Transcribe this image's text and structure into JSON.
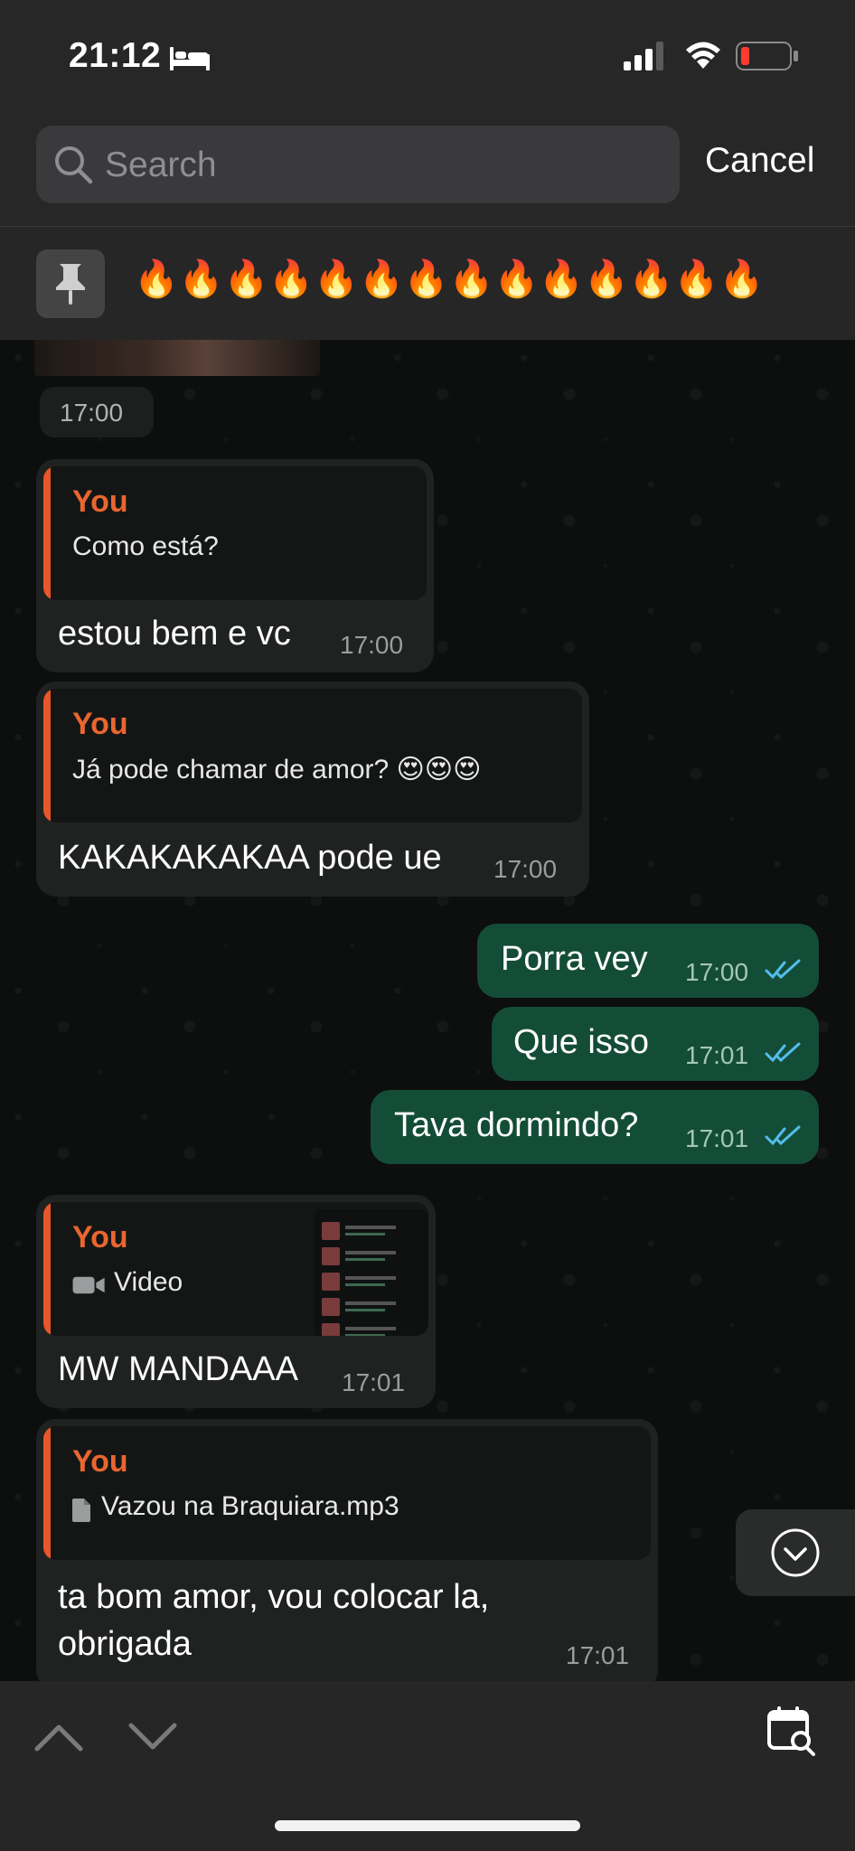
{
  "status_bar": {
    "time": "21:12"
  },
  "search": {
    "placeholder": "Search",
    "cancel_label": "Cancel"
  },
  "pinned": {
    "text": "🔥🔥🔥🔥🔥🔥🔥🔥🔥🔥🔥🔥🔥🔥"
  },
  "messages": [
    {
      "type": "time-only",
      "time": "17:00"
    },
    {
      "direction": "in",
      "reply_name": "You",
      "reply_text": "Como está?",
      "text": "estou bem e vc",
      "time": "17:00"
    },
    {
      "direction": "in",
      "reply_name": "You",
      "reply_text": "Já pode chamar de amor? 😍😍😍",
      "text": "KAKAKAKAKAA pode ue",
      "time": "17:00"
    },
    {
      "direction": "out",
      "text": "Porra vey",
      "time": "17:00",
      "status": "read"
    },
    {
      "direction": "out",
      "text": "Que isso",
      "time": "17:01",
      "status": "read"
    },
    {
      "direction": "out",
      "text": "Tava dormindo?",
      "time": "17:01",
      "status": "read"
    },
    {
      "direction": "in",
      "reply_name": "You",
      "reply_text": "Video",
      "reply_icon": "video-camera-icon",
      "text": "MW MANDAAA",
      "time": "17:01"
    },
    {
      "direction": "in",
      "reply_name": "You",
      "reply_text": "Vazou na Braquiara.mp3",
      "reply_icon": "document-icon",
      "text_line1": "ta bom amor, vou colocar la,",
      "text_line2": "obrigada",
      "time": "17:01"
    }
  ],
  "colors": {
    "outgoing_bubble": "#144d37",
    "incoming_bubble": "#202222",
    "reply_accent": "#e9562a",
    "read_ticks": "#53bdeb"
  },
  "icons": [
    "bed-icon",
    "signal-icon",
    "wifi-icon",
    "battery-icon",
    "search-icon",
    "pin-icon",
    "chevron-up-icon",
    "chevron-down-icon",
    "calendar-search-icon",
    "scroll-down-icon"
  ]
}
